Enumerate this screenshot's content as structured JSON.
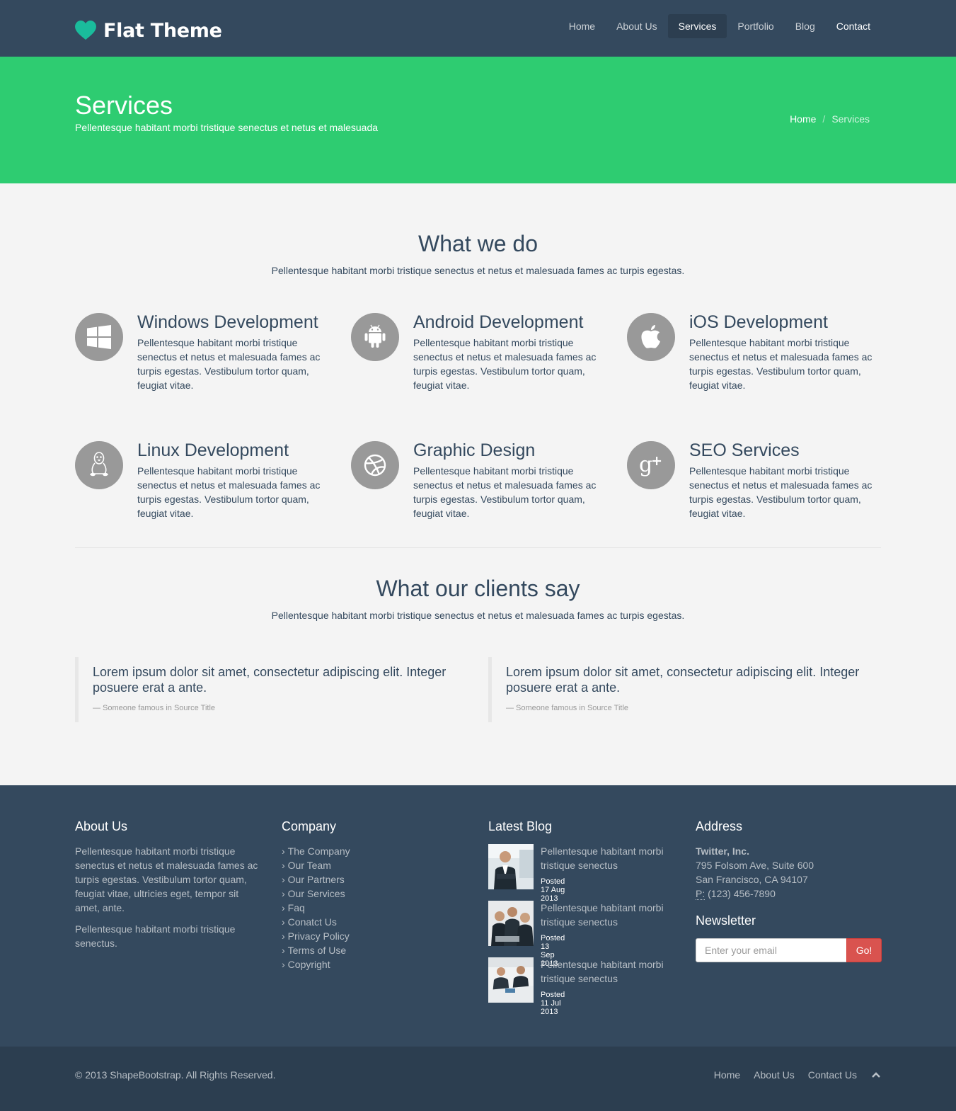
{
  "brand": {
    "name": "Flat Theme",
    "color": "#1abc9c"
  },
  "nav": {
    "items": [
      "Home",
      "About Us",
      "Services",
      "Portfolio",
      "Blog",
      "Contact"
    ],
    "active": "Services"
  },
  "title_band": {
    "title": "Services",
    "subtitle": "Pellentesque habitant morbi tristique senectus et netus et malesuada",
    "breadcrumb": [
      "Home",
      "Services"
    ],
    "separator": "/",
    "color": "#2ecc71"
  },
  "what_we_do": {
    "heading": "What we do",
    "lead": "Pellentesque habitant morbi tristique senectus et netus et malesuada fames ac turpis egestas.",
    "services": [
      {
        "icon": "windows-icon",
        "title": "Windows Development",
        "text": "Pellentesque habitant morbi tristique senectus et netus et malesuada fames ac turpis egestas. Vestibulum tortor quam, feugiat vitae."
      },
      {
        "icon": "android-icon",
        "title": "Android Development",
        "text": "Pellentesque habitant morbi tristique senectus et netus et malesuada fames ac turpis egestas. Vestibulum tortor quam, feugiat vitae."
      },
      {
        "icon": "apple-icon",
        "title": "iOS Development",
        "text": "Pellentesque habitant morbi tristique senectus et netus et malesuada fames ac turpis egestas. Vestibulum tortor quam, feugiat vitae."
      },
      {
        "icon": "linux-icon",
        "title": "Linux Development",
        "text": "Pellentesque habitant morbi tristique senectus et netus et malesuada fames ac turpis egestas. Vestibulum tortor quam, feugiat vitae."
      },
      {
        "icon": "dribbble-icon",
        "title": "Graphic Design",
        "text": "Pellentesque habitant morbi tristique senectus et netus et malesuada fames ac turpis egestas. Vestibulum tortor quam, feugiat vitae."
      },
      {
        "icon": "google-plus-icon",
        "title": "SEO Services",
        "text": "Pellentesque habitant morbi tristique senectus et netus et malesuada fames ac turpis egestas. Vestibulum tortor quam, feugiat vitae."
      }
    ]
  },
  "testimonials": {
    "heading": "What our clients say",
    "lead": "Pellentesque habitant morbi tristique senectus et netus et malesuada fames ac turpis egestas.",
    "quotes": [
      {
        "text": "Lorem ipsum dolor sit amet, consectetur adipiscing elit. Integer posuere erat a ante.",
        "source": "— Someone famous in Source Title"
      },
      {
        "text": "Lorem ipsum dolor sit amet, consectetur adipiscing elit. Integer posuere erat a ante.",
        "source": "— Someone famous in Source Title"
      }
    ]
  },
  "footer": {
    "about": {
      "heading": "About Us",
      "paragraphs": [
        "Pellentesque habitant morbi tristique senectus et netus et malesuada fames ac turpis egestas. Vestibulum tortor quam, feugiat vitae, ultricies eget, tempor sit amet, ante.",
        "Pellentesque habitant morbi tristique senectus."
      ]
    },
    "company": {
      "heading": "Company",
      "links": [
        "The Company",
        "Our Team",
        "Our Partners",
        "Our Services",
        "Faq",
        "Conatct Us",
        "Privacy Policy",
        "Terms of Use",
        "Copyright"
      ]
    },
    "blog": {
      "heading": "Latest Blog",
      "posts": [
        {
          "title": "Pellentesque habitant morbi tristique senectus",
          "date": "Posted 17 Aug 2013"
        },
        {
          "title": "Pellentesque habitant morbi tristique senectus",
          "date": "Posted 13 Sep 2013"
        },
        {
          "title": "Pellentesque habitant morbi tristique senectus",
          "date": "Posted 11 Jul 2013"
        }
      ]
    },
    "address": {
      "heading": "Address",
      "company": "Twitter, Inc.",
      "line1": "795 Folsom Ave, Suite 600",
      "line2": "San Francisco, CA 94107",
      "phone_label": "P:",
      "phone": "(123) 456-7890"
    },
    "newsletter": {
      "heading": "Newsletter",
      "placeholder": "Enter your email",
      "button": "Go!",
      "button_color": "#d9534f"
    }
  },
  "bottom_bar": {
    "copyright": "© 2013 ShapeBootstrap. All Rights Reserved.",
    "links": [
      "Home",
      "About Us",
      "Contact Us"
    ],
    "top_icon": "chevron-up-icon"
  }
}
